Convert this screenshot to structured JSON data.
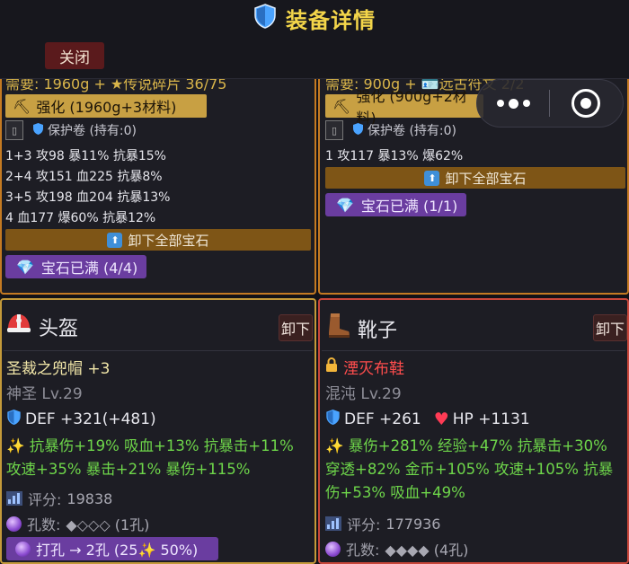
{
  "header": {
    "title": "装备详情",
    "close_label": "关闭"
  },
  "top_left": {
    "cut_line": "需要: 1960g + ★传说碎片 36/75",
    "enhance_label": "强化 (1960g+3材料)",
    "protect_label": "保护卷 (持有:0)",
    "gem_lines": [
      "1+3 攻98 暴11% 抗暴15%",
      "2+4 攻151 血225 抗暴8%",
      "3+5 攻198 血204 抗暴13%",
      "4 血177 爆60% 抗暴12%"
    ],
    "remove_gems_label": "卸下全部宝石",
    "gems_full_label": "宝石已满 (4/4)"
  },
  "top_right": {
    "cut_line": "需要: 900g + 🪪远古符文 2/2",
    "enhance_label": "强化 (900g+2材料)",
    "protect_label": "保护卷 (持有:0)",
    "gem_lines": [
      "1 攻117 暴13% 爆62%"
    ],
    "remove_gems_label": "卸下全部宝石",
    "gems_full_label": "宝石已满 (1/1)"
  },
  "helmet": {
    "slot_label": "头盔",
    "unequip_label": "卸下",
    "name": "圣裁之兜帽 +3",
    "tier": "神圣 Lv.29",
    "def_text": "DEF +321(+481)",
    "bonus_text": "抗暴伤+19% 吸血+13% 抗暴击+11% 攻速+35% 暴击+21% 暴伤+115%",
    "score_label": "评分: ",
    "score_value": "19838",
    "holes_label": "孔数: ",
    "holes_value": "◆◇◇◇ (1孔)",
    "punch_label": "打孔 → 2孔 (25✨ 50%)"
  },
  "boots": {
    "slot_label": "靴子",
    "unequip_label": "卸下",
    "name": "湮灭布鞋",
    "tier": "混沌 Lv.29",
    "def_text": "DEF +261",
    "hp_text": "HP +1131",
    "bonus_text": "暴伤+281% 经验+47% 抗暴击+30% 穿透+82% 金币+105% 攻速+105% 抗暴伤+53% 吸血+49%",
    "score_label": "评分: ",
    "score_value": "177936",
    "holes_label": "孔数: ",
    "holes_value": "◆◆◆◆ (4孔)"
  },
  "colors": {
    "title_gold": "#f3d54a",
    "legendary_orange": "#c47a22",
    "bonus_green": "#6ed64a",
    "chaos_red": "#ff4d4d",
    "holy_yellow": "#f1e6a8",
    "gem_purple": "#6a3da0"
  },
  "icons": [
    "shield-icon",
    "hammer-icon",
    "helmet-icon",
    "boot-icon",
    "lock-icon",
    "heart-icon",
    "sparkle-icon",
    "chart-icon",
    "orb-icon",
    "gem-icon",
    "up-arrow-icon"
  ]
}
